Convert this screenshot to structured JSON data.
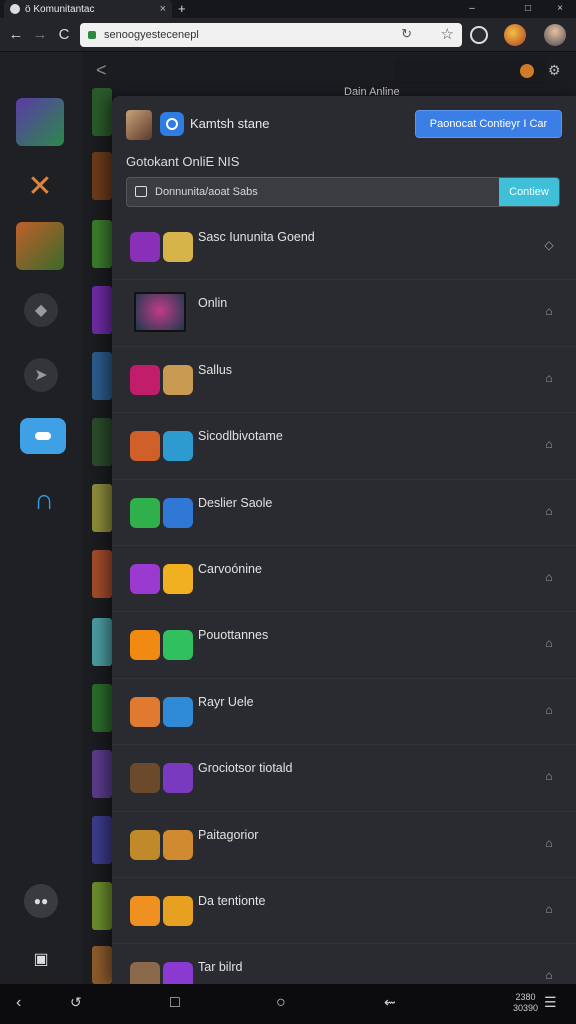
{
  "browser": {
    "tab_title": "ö Komunitantac",
    "tab_close": "×",
    "new_tab": "+",
    "window_controls": [
      "–",
      "□",
      "×"
    ],
    "url": "senoogyestecenepl",
    "back": "←",
    "forward": "→",
    "reload": "C",
    "omni_reload": "↻",
    "bookmark": "☆"
  },
  "top": {
    "back": "<",
    "title": "Dain Anline",
    "settings": "⚙"
  },
  "panel": {
    "header_name": "Kamtsh stane",
    "header_button": "Paonocat Contieyr I Car",
    "section_title": "Gotokant OnliE NIS",
    "search": {
      "placeholder": "Donnunita/aoat Sabs",
      "button": "Contiew"
    },
    "items": [
      {
        "label": "Sasc Iununita Goend",
        "icon_a": "#8a2fb8",
        "icon_b": "#d6b44a",
        "action": "◇"
      },
      {
        "label": "Onlin",
        "icon_a": "#c23b8c",
        "icon_b": "",
        "action": "⌂",
        "big": true
      },
      {
        "label": "Sallus",
        "icon_a": "#c21d6a",
        "icon_b": "#c99a52",
        "action": "⌂"
      },
      {
        "label": "Sicodlbivotame",
        "icon_a": "#d0602a",
        "icon_b": "#2e9bd0",
        "action": "⌂"
      },
      {
        "label": "Deslier Saole",
        "icon_a": "#2fb04a",
        "icon_b": "#2f78d6",
        "action": "⌂"
      },
      {
        "label": "Carvoónine",
        "icon_a": "#9a3ad0",
        "icon_b": "#f0b020",
        "action": "⌂"
      },
      {
        "label": "Pouottannes",
        "icon_a": "#f08a10",
        "icon_b": "#30c060",
        "action": "⌂"
      },
      {
        "label": "Rayr Uele",
        "icon_a": "#e07a30",
        "icon_b": "#2f8ad8",
        "action": "⌂"
      },
      {
        "label": "Grociotsor tiotald",
        "icon_a": "#6a4a2a",
        "icon_b": "#7a3ac0",
        "action": "⌂"
      },
      {
        "label": "Paitagorior",
        "icon_a": "#c08a2a",
        "icon_b": "#d08a30",
        "action": "⌂"
      },
      {
        "label": "Da tentionte",
        "icon_a": "#f09020",
        "icon_b": "#e8a020",
        "action": "⌂"
      },
      {
        "label": "Tar bilrd",
        "icon_a": "#8a6a4a",
        "icon_b": "#8a3ad0",
        "action": "⌂"
      }
    ]
  },
  "navbar": {
    "back": "‹",
    "clock_top": "2380",
    "clock_bottom": "30390"
  },
  "colors": {
    "accent_blue": "#3a7ee6",
    "accent_cyan": "#3fbfd8",
    "panel_bg": "#2a2b30",
    "app_bg": "#1b1c20"
  }
}
